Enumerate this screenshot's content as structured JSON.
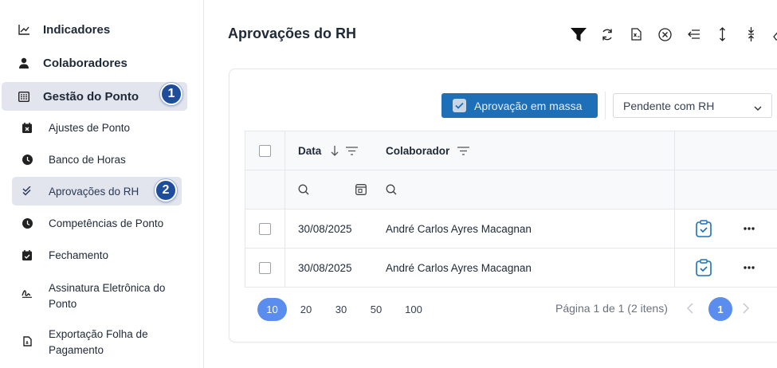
{
  "sidebar": {
    "indicadores": "Indicadores",
    "colaboradores": "Colaboradores",
    "gestao_ponto": "Gestão do Ponto",
    "gestao_badge": "1",
    "sub": {
      "ajustes": "Ajustes de Ponto",
      "banco": "Banco de Horas",
      "aprovacoes": "Aprovações do RH",
      "aprovacoes_badge": "2",
      "competencias": "Competências de Ponto",
      "fechamento": "Fechamento",
      "assinatura_l1": "Assinatura Eletrônica do",
      "assinatura_l2": "Ponto",
      "exportacao_l1": "Exportação Folha de",
      "exportacao_l2": "Pagamento"
    }
  },
  "header": {
    "title": "Aprovações do RH",
    "toolbar_icons": [
      "filter-icon",
      "refresh-icon",
      "export-excel-icon",
      "clear-circle-icon",
      "collapse-left-icon",
      "expand-vertical-icon",
      "compress-vertical-icon",
      "eraser-icon"
    ]
  },
  "actions": {
    "mass_approve": "Aprovação em massa",
    "status_select": "Pendente com RH"
  },
  "table": {
    "columns": {
      "data": "Data",
      "colaborador": "Colaborador"
    },
    "rows": [
      {
        "data": "30/08/2025",
        "colaborador": "André Carlos Ayres Macagnan"
      },
      {
        "data": "30/08/2025",
        "colaborador": "André Carlos Ayres Macagnan"
      }
    ]
  },
  "pagination": {
    "sizes": [
      "10",
      "20",
      "30",
      "50",
      "100"
    ],
    "selected_size": "10",
    "info": "Página 1 de 1 (2 itens)",
    "current_page": "1"
  },
  "colors": {
    "primary": "#1d70b8",
    "accent": "#5b8def",
    "badge": "#1e4d9b",
    "active_bg": "#e2e5ee"
  }
}
